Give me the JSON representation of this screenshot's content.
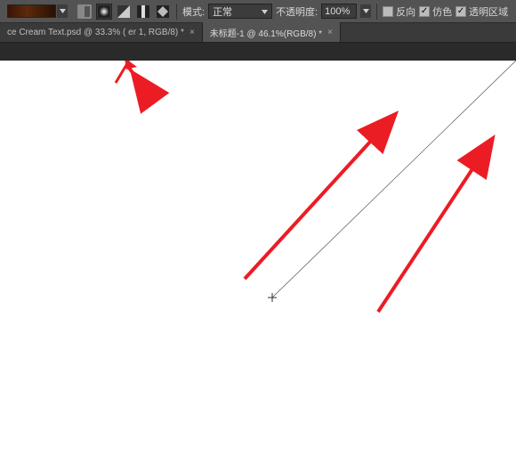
{
  "toolbar": {
    "mode_label": "模式:",
    "mode_value": "正常",
    "opacity_label": "不透明度:",
    "opacity_value": "100%",
    "reverse_label": "反向",
    "dither_label": "仿色",
    "transparency_label": "透明区域",
    "reverse_checked": false,
    "dither_checked": true,
    "transparency_checked": true
  },
  "tabs": [
    {
      "title": "ce Cream Text.psd @ 33.3% (      er 1, RGB/8) *",
      "active": false
    },
    {
      "title": "未标题-1 @ 46.1%(RGB/8) *",
      "active": true
    }
  ]
}
